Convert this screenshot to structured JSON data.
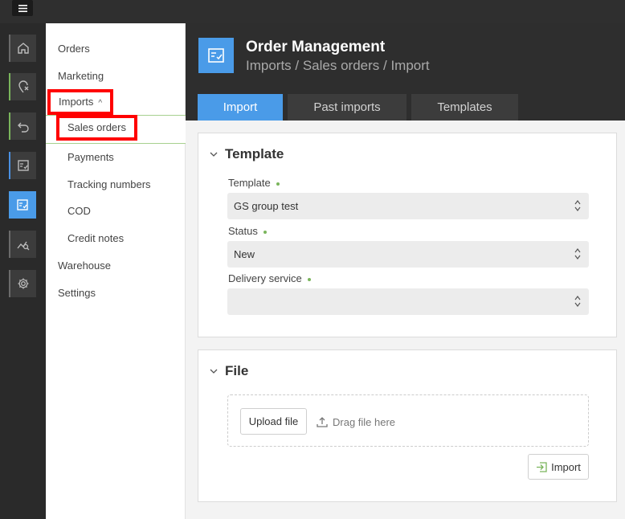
{
  "nav": {
    "orders": "Orders",
    "marketing": "Marketing",
    "imports": "Imports",
    "sales_orders": "Sales orders",
    "payments": "Payments",
    "tracking_numbers": "Tracking numbers",
    "cod": "COD",
    "credit_notes": "Credit notes",
    "warehouse": "Warehouse",
    "settings": "Settings"
  },
  "header": {
    "title": "Order Management",
    "breadcrumb": "Imports / Sales orders / Import"
  },
  "tabs": {
    "import": "Import",
    "past_imports": "Past imports",
    "templates": "Templates"
  },
  "template_section": {
    "title": "Template",
    "template_label": "Template",
    "template_value": "GS group test",
    "status_label": "Status",
    "status_value": "New",
    "delivery_label": "Delivery service",
    "delivery_value": ""
  },
  "file_section": {
    "title": "File",
    "upload_label": "Upload file",
    "drag_text": "Drag file here",
    "import_label": "Import"
  },
  "colors": {
    "accent": "#4a9be8",
    "required_dot": "#7ab55c",
    "highlight_box": "#ff0000"
  }
}
